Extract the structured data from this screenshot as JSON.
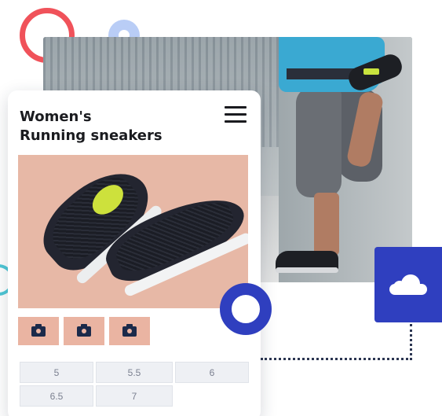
{
  "product": {
    "title_line1": "Women's",
    "title_line2": "Running sneakers"
  },
  "header": {
    "menu_icon": "hamburger-menu-icon"
  },
  "gallery": {
    "thumbnails": [
      {
        "icon": "camera-icon"
      },
      {
        "icon": "camera-icon"
      },
      {
        "icon": "camera-icon"
      }
    ]
  },
  "sizes": [
    "5",
    "5.5",
    "6",
    "6.5",
    "7"
  ],
  "decor": {
    "cloud_icon": "cloud-icon"
  },
  "colors": {
    "accent_blue": "#2f3fbf",
    "accent_red": "#f0525a",
    "accent_teal": "#4fc8d6",
    "thumbnail_bg": "#eab4a2",
    "size_bg": "#eef0f4"
  }
}
